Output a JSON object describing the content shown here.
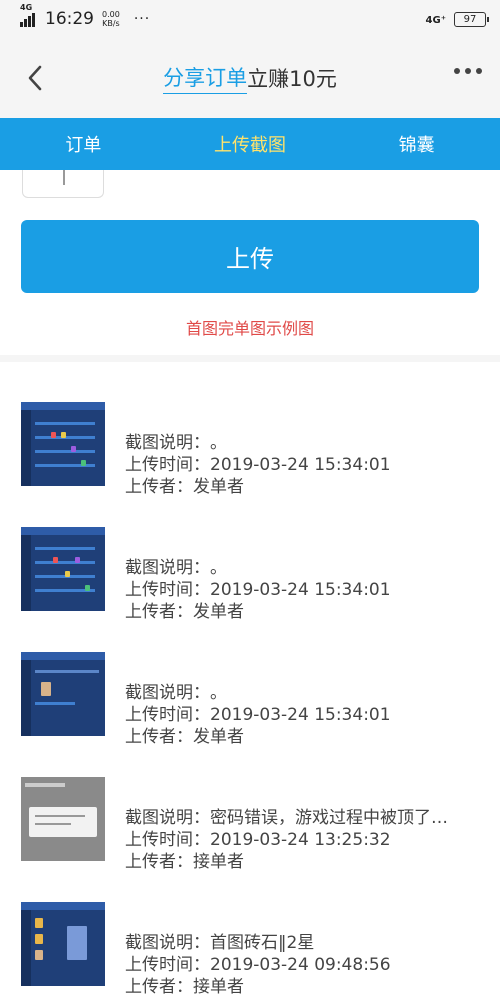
{
  "status": {
    "network_left": "4G",
    "time": "16:29",
    "speed_value": "0.00",
    "speed_unit": "KB/s",
    "more": "···",
    "network_right": "4G⁺",
    "battery": "97"
  },
  "nav": {
    "title_link": "分享订单",
    "title_rest": "立赚10元"
  },
  "tabs": [
    {
      "label": "订单"
    },
    {
      "label": "上传截图"
    },
    {
      "label": "锦囊"
    }
  ],
  "upload": {
    "button_label": "上传",
    "example_link": "首图完单图示例图"
  },
  "labels": {
    "desc": "截图说明：",
    "time": "上传时间：",
    "uploader": "上传者："
  },
  "records": [
    {
      "desc": "。",
      "time": "2019-03-24 15:34:01",
      "uploader": "发单者"
    },
    {
      "desc": "。",
      "time": "2019-03-24 15:34:01",
      "uploader": "发单者"
    },
    {
      "desc": "。",
      "time": "2019-03-24 15:34:01",
      "uploader": "发单者"
    },
    {
      "desc": "密码错误，游戏过程中被顶了…",
      "time": "2019-03-24 13:25:32",
      "uploader": "接单者"
    },
    {
      "desc": "首图砖石‖2星",
      "time": "2019-03-24 09:48:56",
      "uploader": "接单者"
    }
  ],
  "colors": {
    "accent": "#1a9ee4",
    "tab_active": "#ffe36b",
    "link_red": "#e04a48"
  }
}
